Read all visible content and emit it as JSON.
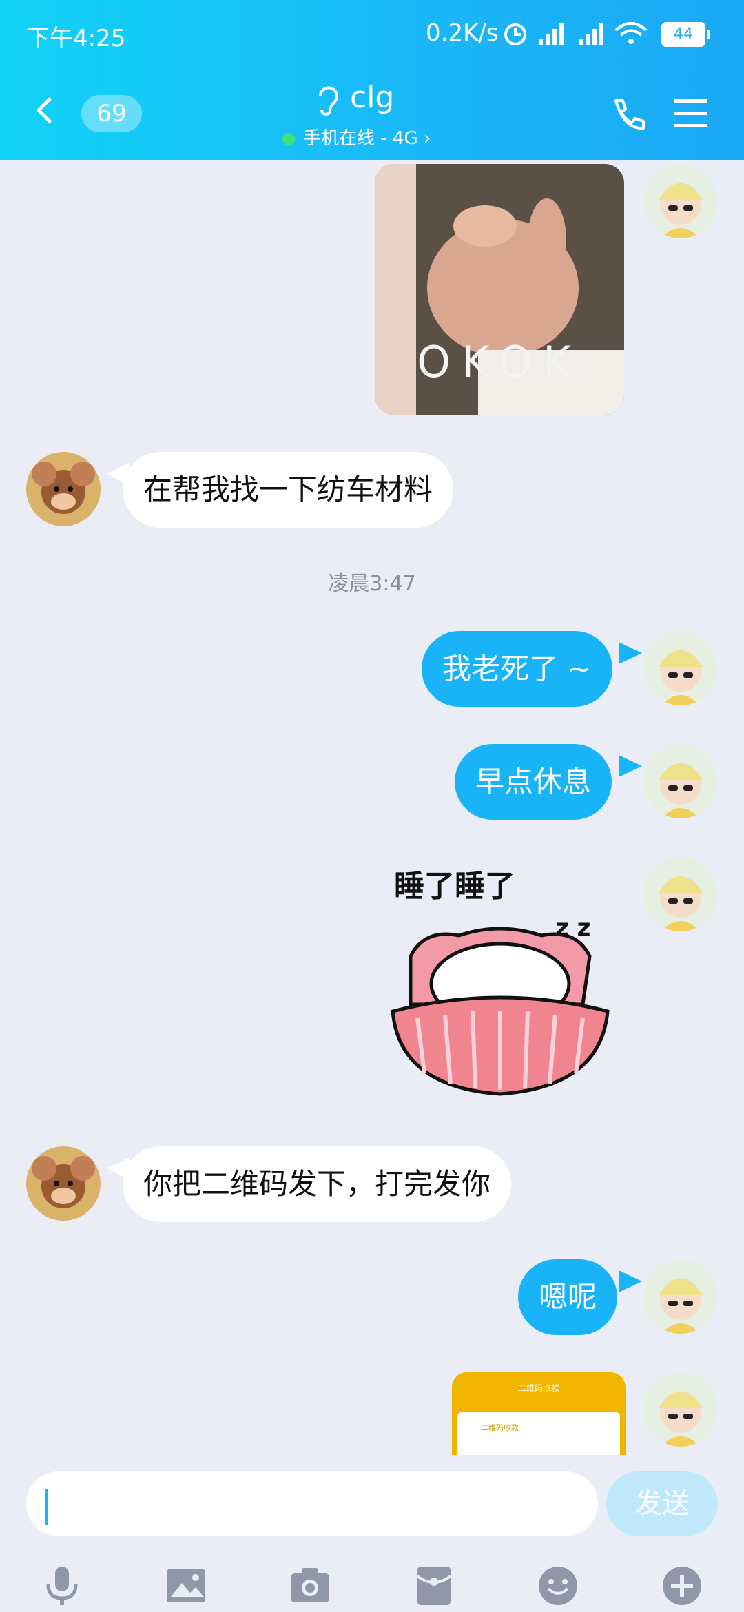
{
  "status_bar": {
    "time": "下午4:25",
    "network_speed": "0.2K/s",
    "battery": "44",
    "icons": [
      "alarm-icon",
      "hd-signal-icon",
      "signal-icon",
      "wifi-icon",
      "battery-icon"
    ]
  },
  "header": {
    "back_icon": "chevron-left-icon",
    "unread_count": "69",
    "contact_name": "clg",
    "ear_icon": "ear-icon",
    "presence": "手机在线 - 4G",
    "phone_icon": "phone-icon",
    "menu_icon": "menu-icon"
  },
  "messages": [
    {
      "sender": "me",
      "kind": "image",
      "caption": "OKOK"
    },
    {
      "sender": "other",
      "kind": "text",
      "text": "在帮我找一下纺车材料"
    },
    {
      "kind": "timestamp",
      "text": "凌晨3:47"
    },
    {
      "sender": "me",
      "kind": "text",
      "text": "我老死了 ~"
    },
    {
      "sender": "me",
      "kind": "text",
      "text": "早点休息"
    },
    {
      "sender": "me",
      "kind": "sticker",
      "caption": "睡了睡了"
    },
    {
      "sender": "other",
      "kind": "text",
      "text": "你把二维码发下，打完发你"
    },
    {
      "sender": "me",
      "kind": "text",
      "text": "嗯呢"
    },
    {
      "sender": "me",
      "kind": "screenshot",
      "title": "二维码收款",
      "card_label": "二维码收款"
    }
  ],
  "input": {
    "placeholder": "",
    "send_label": "发送"
  },
  "toolbar": [
    "microphone-icon",
    "image-icon",
    "camera-icon",
    "red-packet-icon",
    "emoji-icon",
    "plus-icon"
  ],
  "colors": {
    "accent": "#19b4f8",
    "header_start": "#11d3f5",
    "background": "#eaedf5"
  }
}
